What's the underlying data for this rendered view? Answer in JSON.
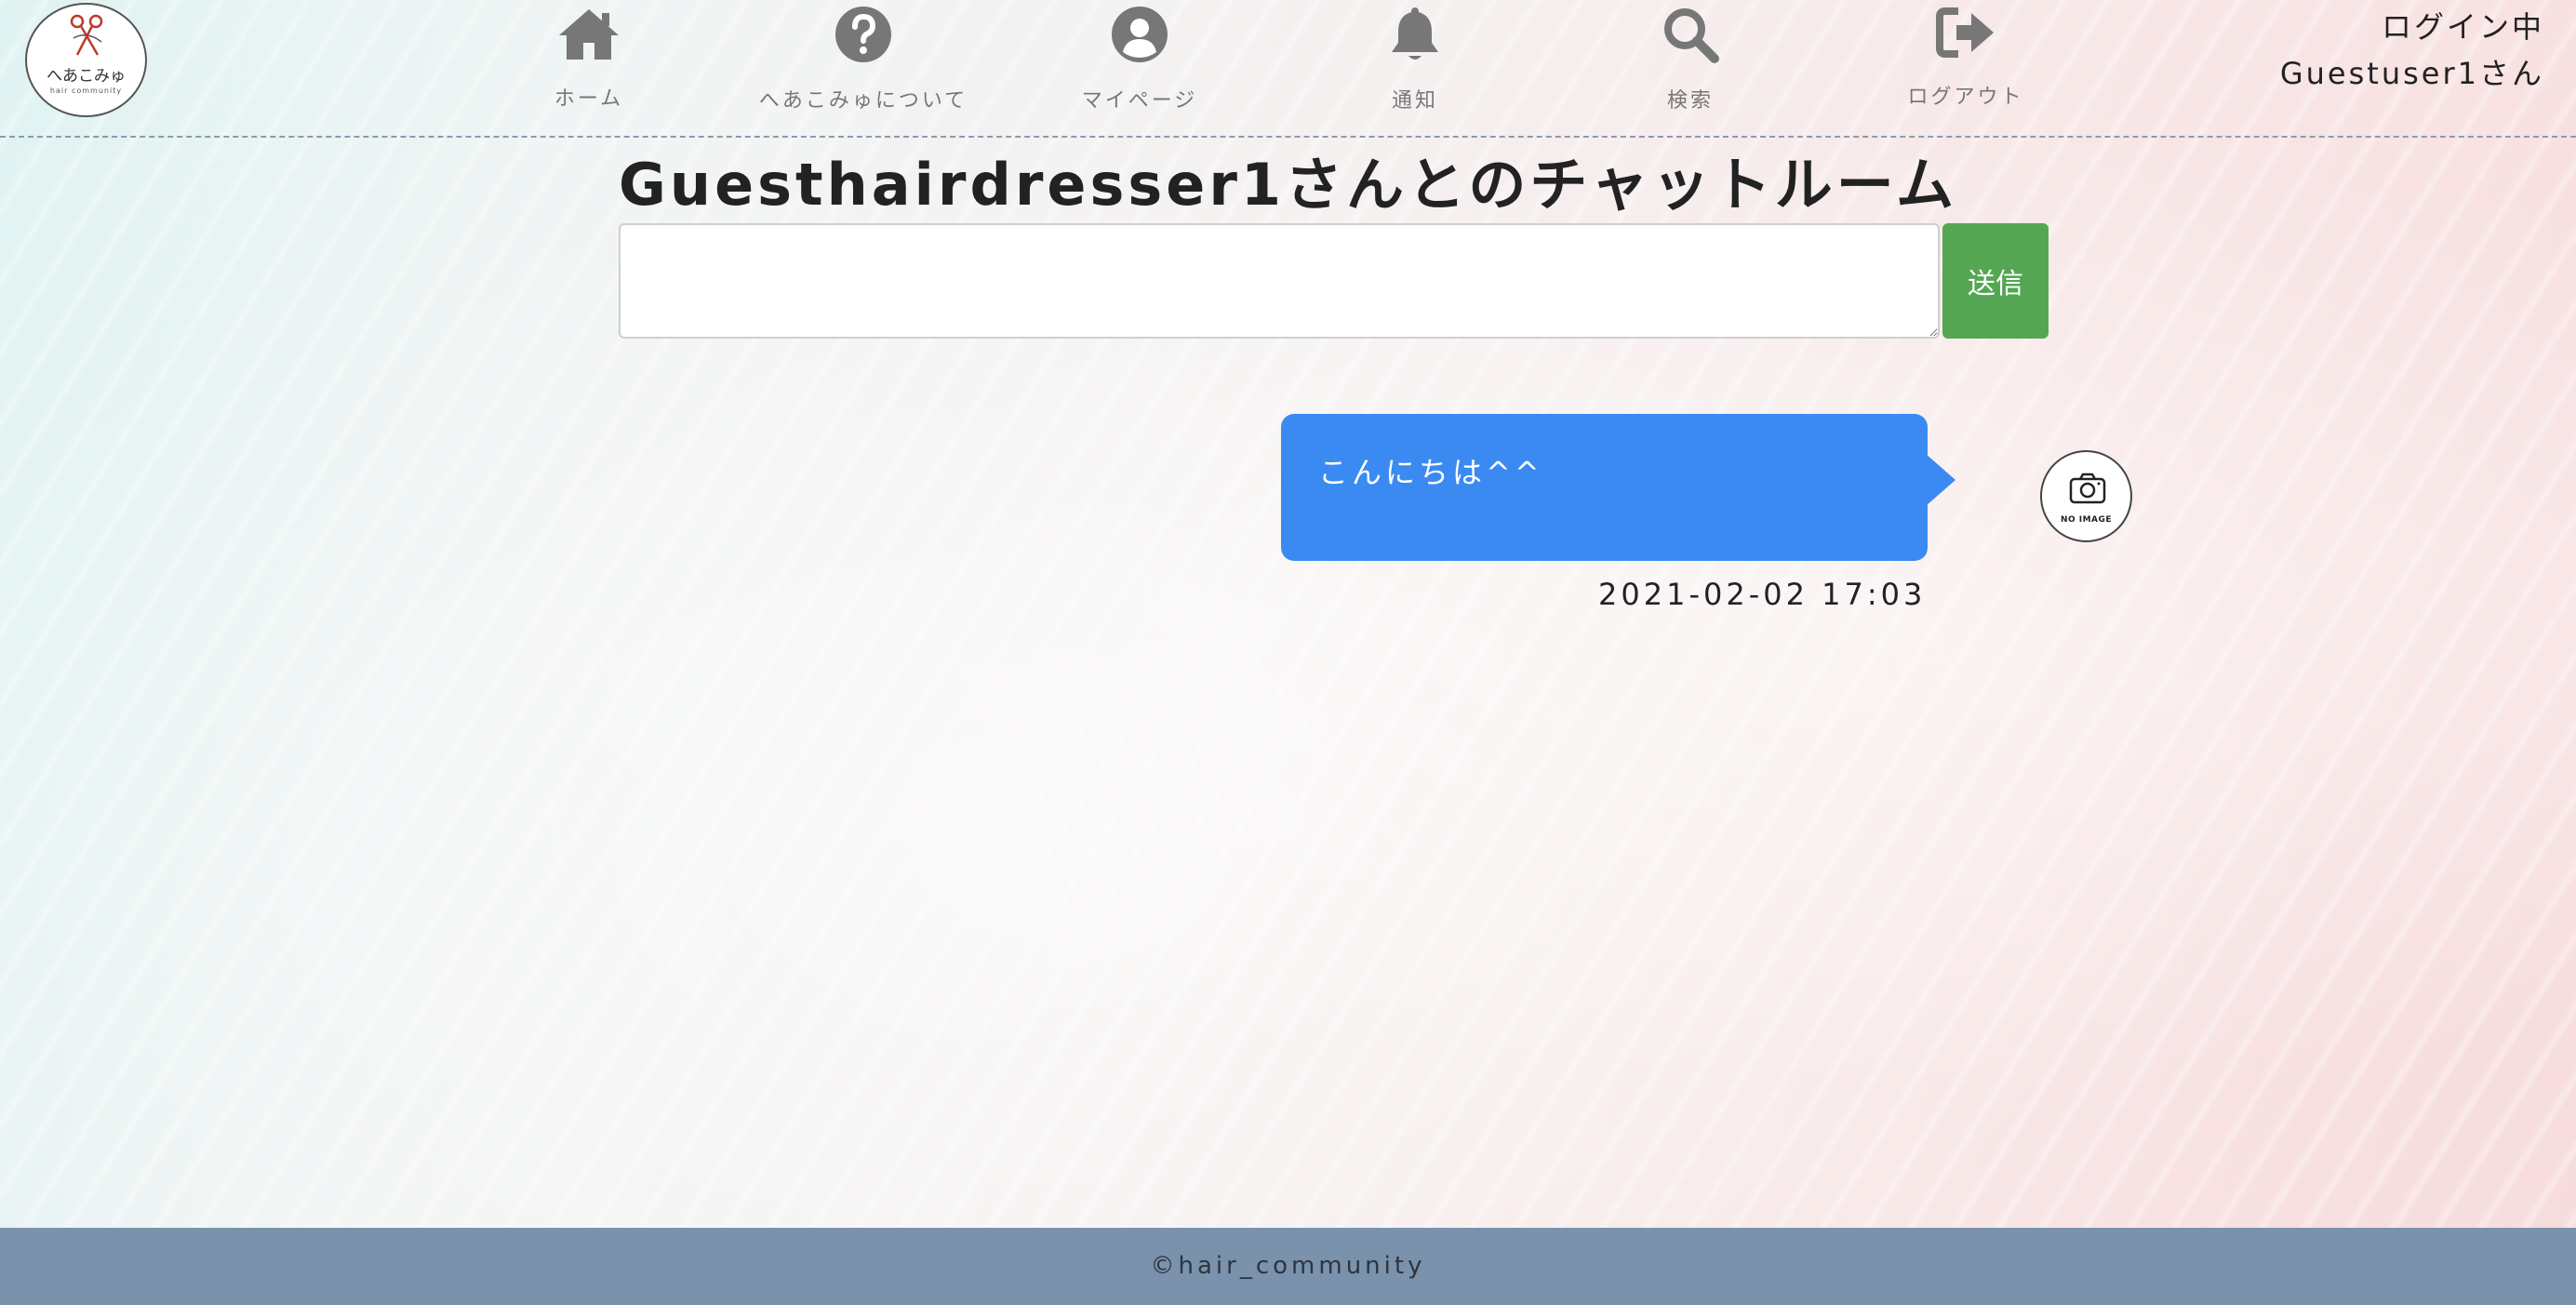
{
  "header": {
    "logo": {
      "text": "へあこみゅ",
      "subtext": "hair community"
    },
    "nav": [
      {
        "label": "ホーム",
        "icon": "home-icon"
      },
      {
        "label": "へあこみゅについて",
        "icon": "question-circle-icon"
      },
      {
        "label": "マイページ",
        "icon": "user-circle-icon"
      },
      {
        "label": "通知",
        "icon": "bell-icon"
      },
      {
        "label": "検索",
        "icon": "search-icon"
      },
      {
        "label": "ログアウト",
        "icon": "logout-icon"
      }
    ],
    "login_status": "ログイン中",
    "user_name": "Guestuser1さん"
  },
  "chat": {
    "title": "Guesthairdresser1さんとのチャットルーム",
    "input": {
      "value": "",
      "placeholder": ""
    },
    "send_label": "送信",
    "messages": [
      {
        "text": "こんにちは^^",
        "timestamp": "2021-02-02 17:03",
        "avatar": "no-image-camera-icon",
        "avatar_text": "NO IMAGE"
      }
    ]
  },
  "footer": {
    "copyright": "©hair_community"
  },
  "colors": {
    "bubble": "#3a8af2",
    "send_button": "#55a653",
    "footer": "#7a92ab",
    "nav_icon": "#777777"
  }
}
